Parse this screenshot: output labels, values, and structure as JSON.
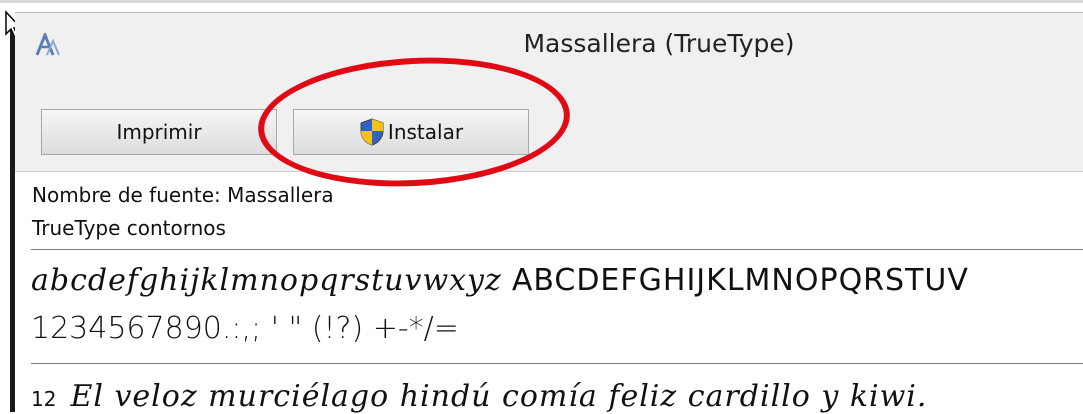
{
  "window": {
    "title": "Massallera (TrueType)"
  },
  "toolbar": {
    "print_label": "Imprimir",
    "install_label": "Instalar"
  },
  "font_info": {
    "name_line": "Nombre de fuente: Massallera",
    "type_line": "TrueType  contornos"
  },
  "samples": {
    "lowercase": "abcdefghijklmnopqrstuvwxyz",
    "uppercase": "ABCDEFGHIJKLMNOPQRSTUV",
    "digits_symbols": "1234567890.:,; ' \" (!?) +-*/=",
    "size_label": "12",
    "pangram": "El veloz murciélago hindú comía feliz cardillo y kiwi."
  },
  "colors": {
    "highlight": "#e10a14",
    "toolbar_bg": "#f0f0f0"
  },
  "icons": {
    "app": "font-viewer-icon",
    "install": "uac-shield-icon"
  }
}
